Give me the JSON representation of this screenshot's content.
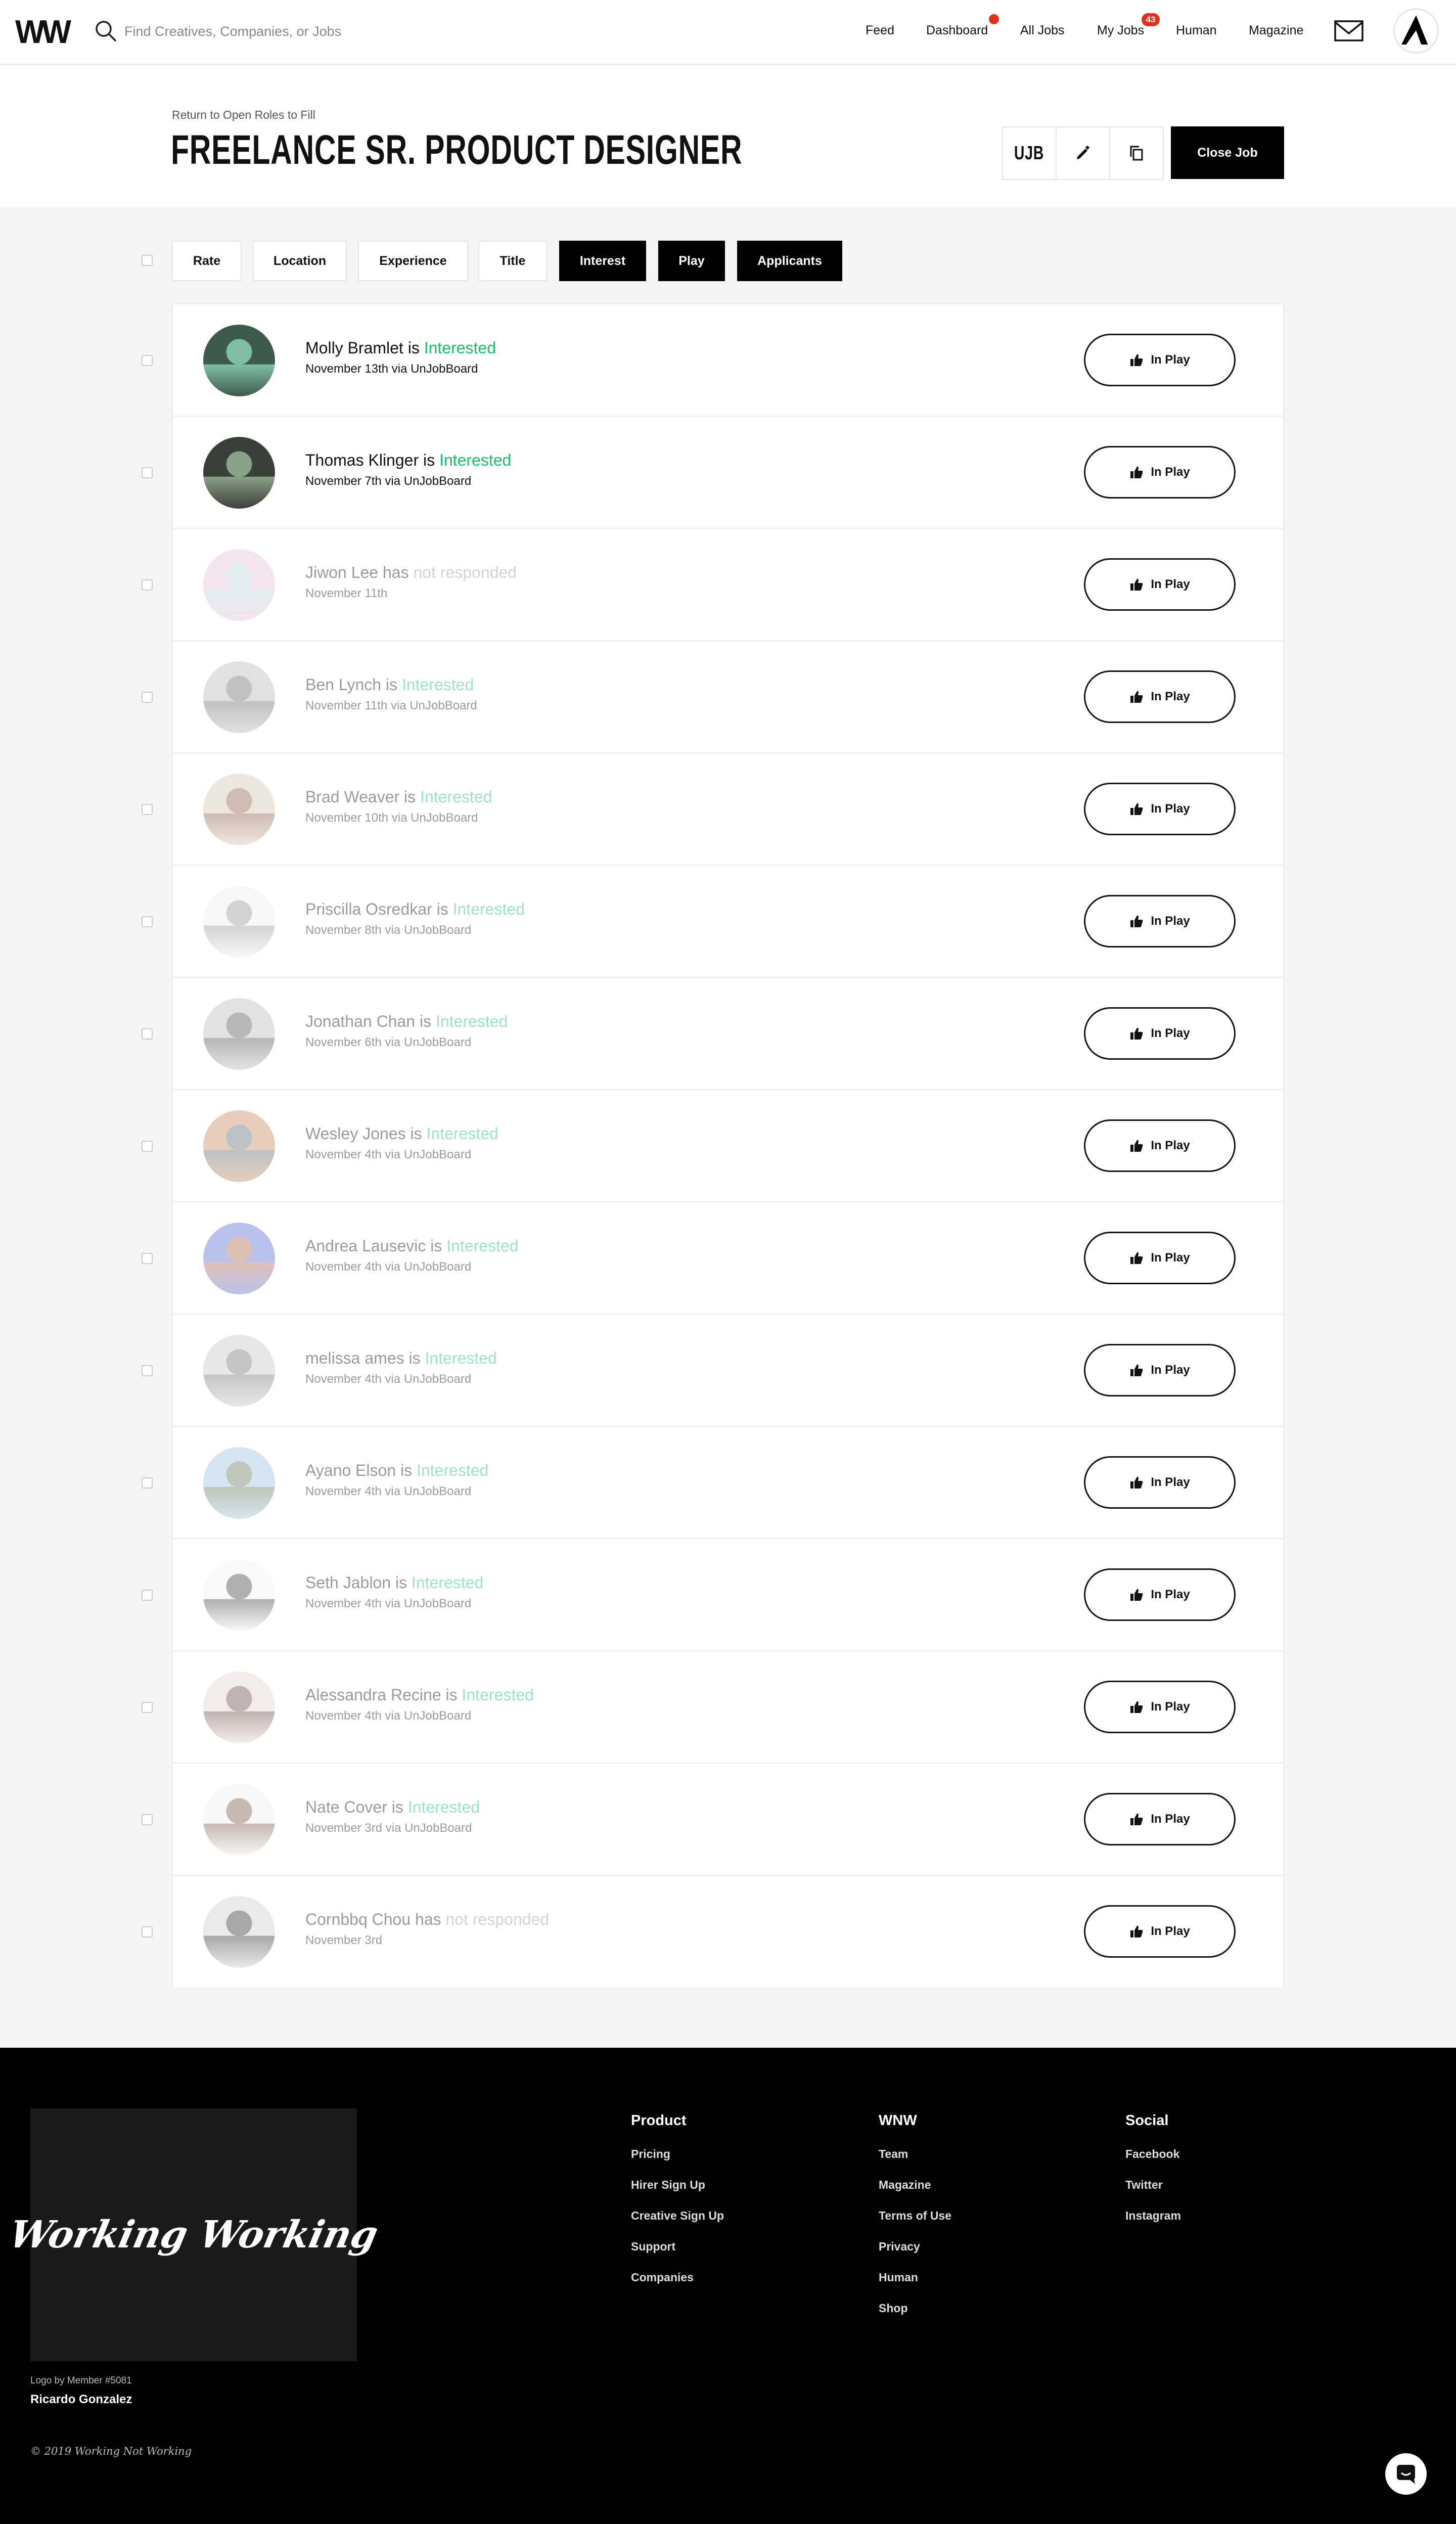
{
  "nav": {
    "logo": "WW",
    "search_placeholder": "Find Creatives, Companies, or Jobs",
    "links": {
      "feed": "Feed",
      "dashboard": "Dashboard",
      "all_jobs": "All Jobs",
      "my_jobs": "My Jobs",
      "human": "Human",
      "magazine": "Magazine"
    },
    "my_jobs_badge": "43",
    "badge_color": "#e0321e"
  },
  "header": {
    "return_link": "Return to Open Roles to Fill",
    "title": "FREELANCE SR. PRODUCT DESIGNER",
    "tools": {
      "ujb": "UJB",
      "edit_icon": "pencil-icon",
      "copy_icon": "copy-icon"
    },
    "close_button": "Close Job"
  },
  "filters": [
    "Rate",
    "Location",
    "Experience",
    "Title",
    "Interest",
    "Play",
    "Applicants"
  ],
  "active_filters": [
    "Interest",
    "Play",
    "Applicants"
  ],
  "status_colors": {
    "interested": "#1bbf6b",
    "not_responded": "#bbbbbb"
  },
  "candidates": [
    {
      "name": "Molly Bramlet",
      "verb": "is",
      "status": "Interested",
      "date": "November 13th via UnJobBoard",
      "action": "In Play",
      "dim": false
    },
    {
      "name": "Thomas Klinger",
      "verb": "is",
      "status": "Interested",
      "date": "November 7th via UnJobBoard",
      "action": "In Play",
      "dim": false
    },
    {
      "name": "Jiwon Lee",
      "verb": "has",
      "status": "not responded",
      "date": "November 11th",
      "action": "In Play",
      "dim": true
    },
    {
      "name": "Ben Lynch",
      "verb": "is",
      "status": "Interested",
      "date": "November 11th via UnJobBoard",
      "action": "In Play",
      "dim": true
    },
    {
      "name": "Brad Weaver",
      "verb": "is",
      "status": "Interested",
      "date": "November 10th via UnJobBoard",
      "action": "In Play",
      "dim": true
    },
    {
      "name": "Priscilla Osredkar",
      "verb": "is",
      "status": "Interested",
      "date": "November 8th via UnJobBoard",
      "action": "In Play",
      "dim": true
    },
    {
      "name": "Jonathan Chan",
      "verb": "is",
      "status": "Interested",
      "date": "November 6th via UnJobBoard",
      "action": "In Play",
      "dim": true
    },
    {
      "name": "Wesley Jones",
      "verb": "is",
      "status": "Interested",
      "date": "November 4th via UnJobBoard",
      "action": "In Play",
      "dim": true
    },
    {
      "name": "Andrea Lausevic",
      "verb": "is",
      "status": "Interested",
      "date": "November 4th via UnJobBoard",
      "action": "In Play",
      "dim": true
    },
    {
      "name": "melissa ames",
      "verb": "is",
      "status": "Interested",
      "date": "November 4th via UnJobBoard",
      "action": "In Play",
      "dim": true
    },
    {
      "name": "Ayano Elson",
      "verb": "is",
      "status": "Interested",
      "date": "November 4th via UnJobBoard",
      "action": "In Play",
      "dim": true
    },
    {
      "name": "Seth Jablon",
      "verb": "is",
      "status": "Interested",
      "date": "November 4th via UnJobBoard",
      "action": "In Play",
      "dim": true
    },
    {
      "name": "Alessandra Recine",
      "verb": "is",
      "status": "Interested",
      "date": "November 4th via UnJobBoard",
      "action": "In Play",
      "dim": true
    },
    {
      "name": "Nate Cover",
      "verb": "is",
      "status": "Interested",
      "date": "November 3rd via UnJobBoard",
      "action": "In Play",
      "dim": true
    },
    {
      "name": "Cornbbq Chou",
      "verb": "has",
      "status": "not responded",
      "date": "November 3rd",
      "action": "In Play",
      "dim": true
    }
  ],
  "footer": {
    "logo_text": "Working Working",
    "logo_credit": "Logo by Member #5081",
    "logo_author": "Ricardo Gonzalez",
    "copyright": "© 2019 Working Not Working",
    "columns": [
      {
        "title": "Product",
        "links": [
          "Pricing",
          "Hirer Sign Up",
          "Creative Sign Up",
          "Support",
          "Companies"
        ]
      },
      {
        "title": "WNW",
        "links": [
          "Team",
          "Magazine",
          "Terms of Use",
          "Privacy",
          "Human",
          "Shop"
        ]
      },
      {
        "title": "Social",
        "links": [
          "Facebook",
          "Twitter",
          "Instagram"
        ]
      }
    ]
  }
}
